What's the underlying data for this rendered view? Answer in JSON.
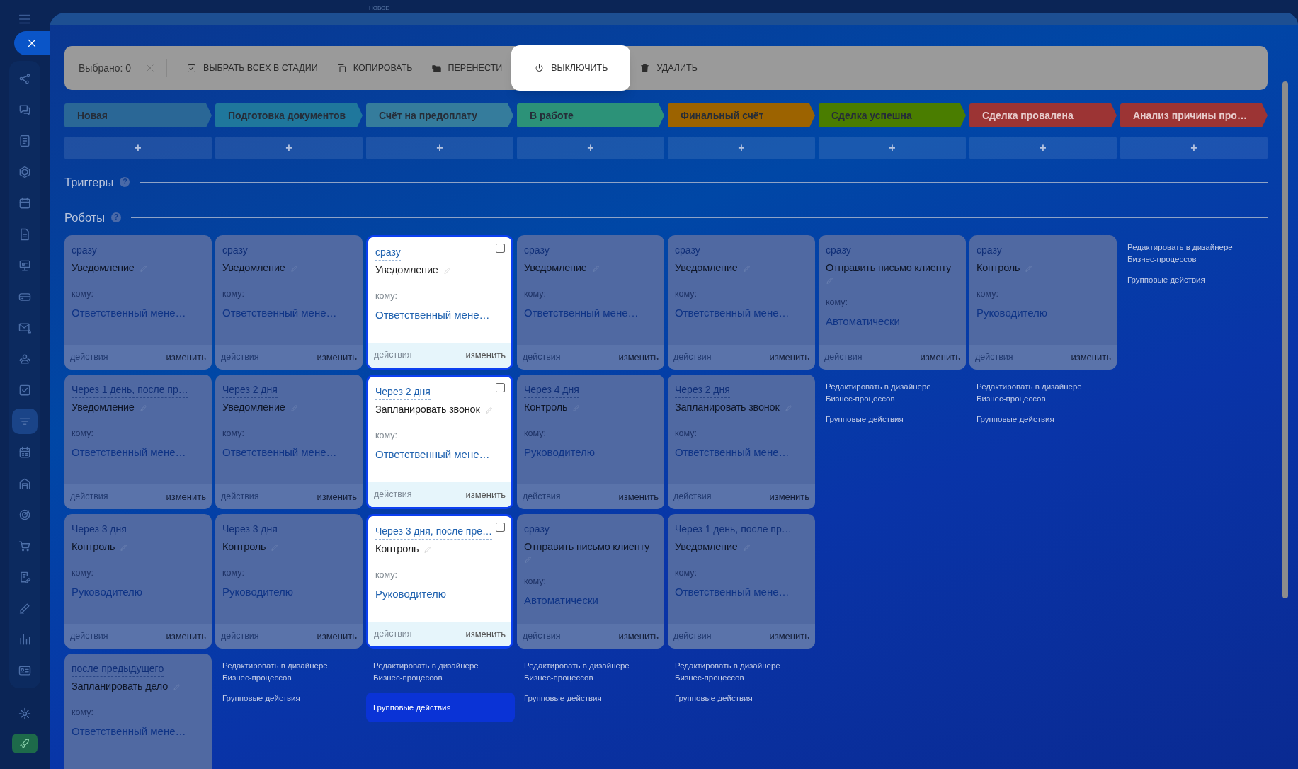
{
  "top_label": "НОВОЕ",
  "toolbar": {
    "selected_count": "Выбрано: 0",
    "actions": [
      {
        "kind": "select_all",
        "label": "ВЫБРАТЬ ВСЕХ В СТАДИИ",
        "highlighted": false
      },
      {
        "kind": "copy",
        "label": "КОПИРОВАТЬ",
        "highlighted": false
      },
      {
        "kind": "move",
        "label": "ПЕРЕНЕСТИ",
        "highlighted": false
      },
      {
        "kind": "power",
        "label": "ВЫКЛЮЧИТЬ",
        "highlighted": true
      },
      {
        "kind": "delete",
        "label": "УДАЛИТЬ",
        "highlighted": false
      }
    ]
  },
  "stages": [
    {
      "name": "Новая",
      "color": "#2a6796",
      "add": "+"
    },
    {
      "name": "Подготовка документов",
      "color": "#1f779c",
      "add": "+"
    },
    {
      "name": "Счёт на предоплату",
      "color": "#357c9c",
      "add": "+"
    },
    {
      "name": "В работе",
      "color": "#2c9278",
      "add": "+"
    },
    {
      "name": "Финальный счёт",
      "color": "#9c6300",
      "add": "+"
    },
    {
      "name": "Сделка успешна",
      "color": "#4a7d00",
      "add": "+"
    },
    {
      "name": "Сделка провалена",
      "color": "#9c3434",
      "add": "+"
    },
    {
      "name": "Анализ причины про…",
      "color": "#9c3434",
      "add": "+"
    }
  ],
  "triggers": {
    "title": "Триггеры",
    "help": "?"
  },
  "robots": {
    "title": "Роботы",
    "help": "?",
    "columns": [
      {
        "highlighted": false,
        "robots": [
          {
            "timing": "сразу",
            "title": "Уведомление",
            "to_label": "кому:",
            "to": "Ответственный мене…",
            "footer": [
              "действия",
              "изменить"
            ]
          },
          {
            "timing": "Через 1 день, после пр…",
            "title": "Уведомление",
            "to_label": "кому:",
            "to": "Ответственный мене…",
            "footer": [
              "действия",
              "изменить"
            ]
          },
          {
            "timing": "Через 3 дня",
            "title": "Контроль",
            "to_label": "кому:",
            "to": "Руководителю",
            "footer": [
              "действия",
              "изменить"
            ]
          },
          {
            "timing": "после предыдущего",
            "title": "Запланировать дело",
            "to_label": "кому:",
            "to": "Ответственный мене…"
          }
        ]
      },
      {
        "highlighted": false,
        "robots": [
          {
            "timing": "сразу",
            "title": "Уведомление",
            "to_label": "кому:",
            "to": "Ответственный мене…",
            "footer": [
              "действия",
              "изменить"
            ]
          },
          {
            "timing": "Через 2 дня",
            "title": "Уведомление",
            "to_label": "кому:",
            "to": "Ответственный мене…",
            "footer": [
              "действия",
              "изменить"
            ]
          },
          {
            "timing": "Через 3 дня",
            "title": "Контроль",
            "to_label": "кому:",
            "to": "Руководителю",
            "footer": [
              "действия",
              "изменить"
            ]
          }
        ],
        "links": {
          "designer": "Редактировать в дизайнере Бизнес-процессов",
          "group": "Групповые действия",
          "group_highlighted": false
        }
      },
      {
        "highlighted": true,
        "robots": [
          {
            "timing": "сразу",
            "title": "Уведомление",
            "to_label": "кому:",
            "to": "Ответственный мене…",
            "footer": [
              "действия",
              "изменить"
            ],
            "checked": false
          },
          {
            "timing": "Через 2 дня",
            "title": "Запланировать звонок",
            "to_label": "кому:",
            "to": "Ответственный мене…",
            "footer": [
              "действия",
              "изменить"
            ],
            "checked": false
          },
          {
            "timing": "Через 3 дня, после пре…",
            "title": "Контроль",
            "to_label": "кому:",
            "to": "Руководителю",
            "footer": [
              "действия",
              "изменить"
            ],
            "checked": false
          }
        ],
        "links": {
          "designer": "Редактировать в дизайнере Бизнес-процессов",
          "group": "Групповые действия",
          "group_highlighted": true
        }
      },
      {
        "highlighted": false,
        "robots": [
          {
            "timing": "сразу",
            "title": "Уведомление",
            "to_label": "кому:",
            "to": "Ответственный мене…",
            "footer": [
              "действия",
              "изменить"
            ]
          },
          {
            "timing": "Через 4 дня",
            "title": "Контроль",
            "to_label": "кому:",
            "to": "Руководителю",
            "footer": [
              "действия",
              "изменить"
            ]
          },
          {
            "timing": "сразу",
            "title": "Отправить письмо клиенту",
            "to_label": "кому:",
            "to": "Автоматически",
            "footer": [
              "действия",
              "изменить"
            ]
          }
        ],
        "links": {
          "designer": "Редактировать в дизайнере Бизнес-процессов",
          "group": "Групповые действия",
          "group_highlighted": false
        }
      },
      {
        "highlighted": false,
        "robots": [
          {
            "timing": "сразу",
            "title": "Уведомление",
            "to_label": "кому:",
            "to": "Ответственный мене…",
            "footer": [
              "действия",
              "изменить"
            ]
          },
          {
            "timing": "Через 2 дня",
            "title": "Запланировать звонок",
            "to_label": "кому:",
            "to": "Ответственный мене…",
            "footer": [
              "действия",
              "изменить"
            ]
          },
          {
            "timing": "Через 1 день, после пр…",
            "title": "Уведомление",
            "to_label": "кому:",
            "to": "Ответственный мене…",
            "footer": [
              "действия",
              "изменить"
            ]
          }
        ],
        "links": {
          "designer": "Редактировать в дизайнере Бизнес-процессов",
          "group": "Групповые действия",
          "group_highlighted": false
        }
      },
      {
        "highlighted": false,
        "robots": [
          {
            "timing": "сразу",
            "title": "Отправить письмо клиенту",
            "to_label": "кому:",
            "to": "Автоматически",
            "footer": [
              "действия",
              "изменить"
            ]
          }
        ],
        "links": {
          "designer": "Редактировать в дизайнере Бизнес-процессов",
          "group": "Групповые действия",
          "group_highlighted": false
        }
      },
      {
        "highlighted": false,
        "robots": [
          {
            "timing": "сразу",
            "title": "Контроль",
            "to_label": "кому:",
            "to": "Руководителю",
            "footer": [
              "действия",
              "изменить"
            ]
          }
        ],
        "links": {
          "designer": "Редактировать в дизайнере Бизнес-процессов",
          "group": "Групповые действия",
          "group_highlighted": false
        }
      },
      {
        "links": {
          "designer": "Редактировать в дизайнере Бизнес-процессов",
          "group": "Групповые действия",
          "group_highlighted": false
        }
      }
    ]
  }
}
